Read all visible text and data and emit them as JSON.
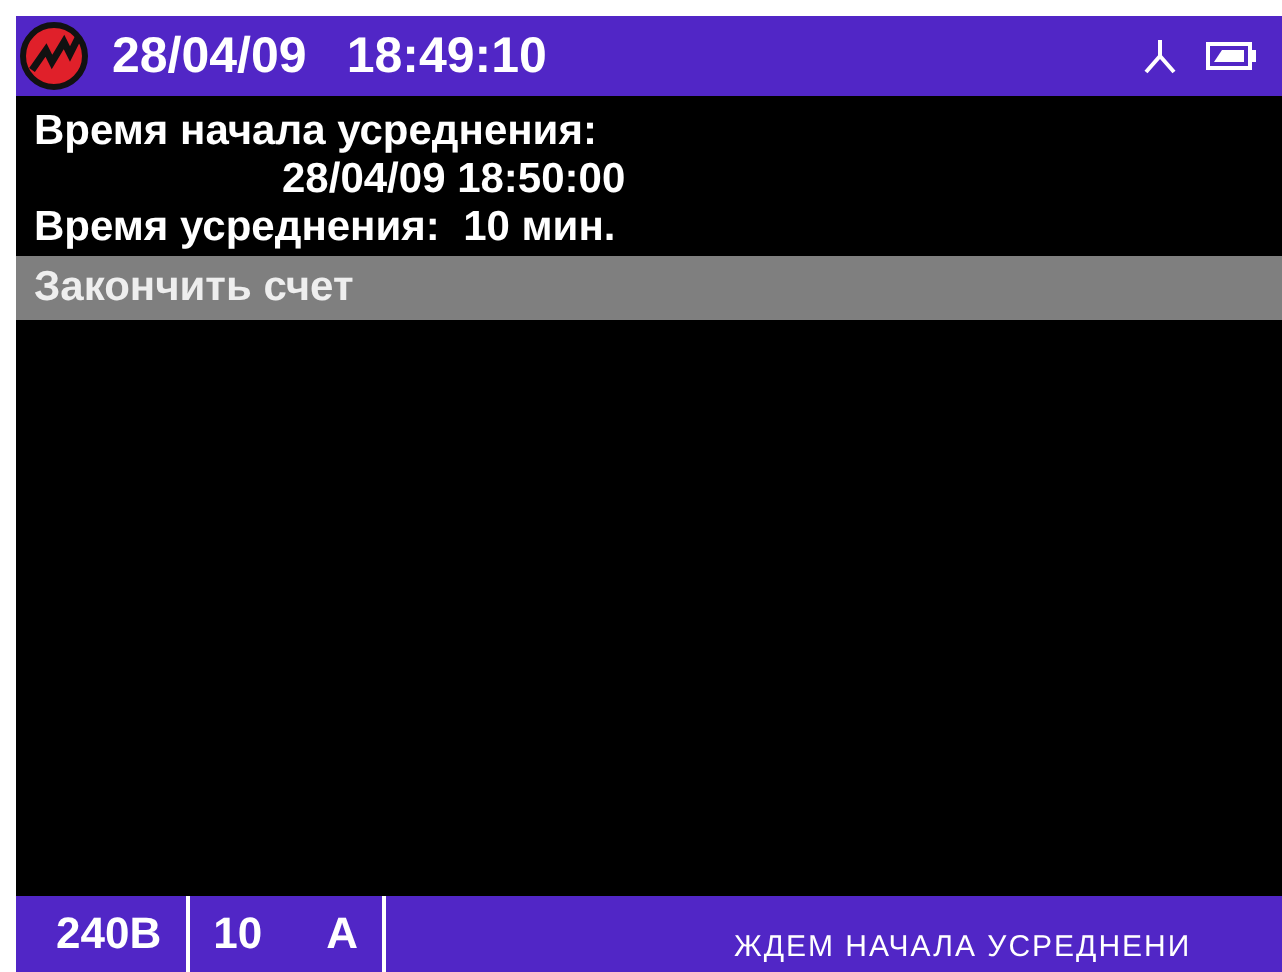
{
  "header": {
    "date": "28/04/09",
    "time": "18:49:10"
  },
  "lines": [
    {
      "kind": "text",
      "text": "Время начала усреднения:"
    },
    {
      "kind": "indent",
      "text": "28/04/09 18:50:00"
    },
    {
      "kind": "text",
      "text": "Время усреднения:  10 мин."
    }
  ],
  "menu": [
    {
      "label": "Закончить счет",
      "selected": true
    }
  ],
  "status_bar": {
    "voltage": "240В",
    "current": "10",
    "unit": "А",
    "message": "ЖДЕМ НАЧАЛА УСРЕДНЕНИ"
  }
}
